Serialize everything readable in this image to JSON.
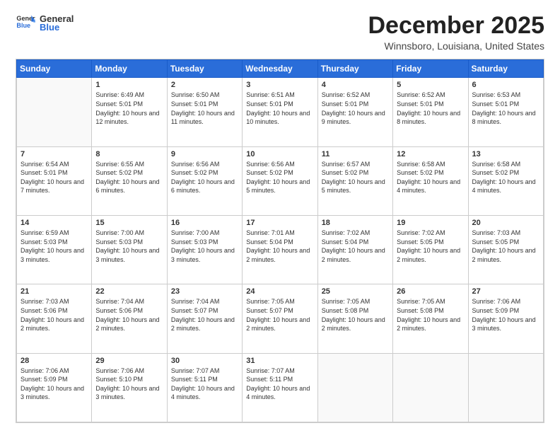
{
  "logo": {
    "general": "General",
    "blue": "Blue"
  },
  "header": {
    "month": "December 2025",
    "location": "Winnsboro, Louisiana, United States"
  },
  "weekdays": [
    "Sunday",
    "Monday",
    "Tuesday",
    "Wednesday",
    "Thursday",
    "Friday",
    "Saturday"
  ],
  "weeks": [
    [
      {
        "day": "",
        "info": ""
      },
      {
        "day": "1",
        "info": "Sunrise: 6:49 AM\nSunset: 5:01 PM\nDaylight: 10 hours\nand 12 minutes."
      },
      {
        "day": "2",
        "info": "Sunrise: 6:50 AM\nSunset: 5:01 PM\nDaylight: 10 hours\nand 11 minutes."
      },
      {
        "day": "3",
        "info": "Sunrise: 6:51 AM\nSunset: 5:01 PM\nDaylight: 10 hours\nand 10 minutes."
      },
      {
        "day": "4",
        "info": "Sunrise: 6:52 AM\nSunset: 5:01 PM\nDaylight: 10 hours\nand 9 minutes."
      },
      {
        "day": "5",
        "info": "Sunrise: 6:52 AM\nSunset: 5:01 PM\nDaylight: 10 hours\nand 8 minutes."
      },
      {
        "day": "6",
        "info": "Sunrise: 6:53 AM\nSunset: 5:01 PM\nDaylight: 10 hours\nand 8 minutes."
      }
    ],
    [
      {
        "day": "7",
        "info": "Sunrise: 6:54 AM\nSunset: 5:01 PM\nDaylight: 10 hours\nand 7 minutes."
      },
      {
        "day": "8",
        "info": "Sunrise: 6:55 AM\nSunset: 5:02 PM\nDaylight: 10 hours\nand 6 minutes."
      },
      {
        "day": "9",
        "info": "Sunrise: 6:56 AM\nSunset: 5:02 PM\nDaylight: 10 hours\nand 6 minutes."
      },
      {
        "day": "10",
        "info": "Sunrise: 6:56 AM\nSunset: 5:02 PM\nDaylight: 10 hours\nand 5 minutes."
      },
      {
        "day": "11",
        "info": "Sunrise: 6:57 AM\nSunset: 5:02 PM\nDaylight: 10 hours\nand 5 minutes."
      },
      {
        "day": "12",
        "info": "Sunrise: 6:58 AM\nSunset: 5:02 PM\nDaylight: 10 hours\nand 4 minutes."
      },
      {
        "day": "13",
        "info": "Sunrise: 6:58 AM\nSunset: 5:02 PM\nDaylight: 10 hours\nand 4 minutes."
      }
    ],
    [
      {
        "day": "14",
        "info": "Sunrise: 6:59 AM\nSunset: 5:03 PM\nDaylight: 10 hours\nand 3 minutes."
      },
      {
        "day": "15",
        "info": "Sunrise: 7:00 AM\nSunset: 5:03 PM\nDaylight: 10 hours\nand 3 minutes."
      },
      {
        "day": "16",
        "info": "Sunrise: 7:00 AM\nSunset: 5:03 PM\nDaylight: 10 hours\nand 3 minutes."
      },
      {
        "day": "17",
        "info": "Sunrise: 7:01 AM\nSunset: 5:04 PM\nDaylight: 10 hours\nand 2 minutes."
      },
      {
        "day": "18",
        "info": "Sunrise: 7:02 AM\nSunset: 5:04 PM\nDaylight: 10 hours\nand 2 minutes."
      },
      {
        "day": "19",
        "info": "Sunrise: 7:02 AM\nSunset: 5:05 PM\nDaylight: 10 hours\nand 2 minutes."
      },
      {
        "day": "20",
        "info": "Sunrise: 7:03 AM\nSunset: 5:05 PM\nDaylight: 10 hours\nand 2 minutes."
      }
    ],
    [
      {
        "day": "21",
        "info": "Sunrise: 7:03 AM\nSunset: 5:06 PM\nDaylight: 10 hours\nand 2 minutes."
      },
      {
        "day": "22",
        "info": "Sunrise: 7:04 AM\nSunset: 5:06 PM\nDaylight: 10 hours\nand 2 minutes."
      },
      {
        "day": "23",
        "info": "Sunrise: 7:04 AM\nSunset: 5:07 PM\nDaylight: 10 hours\nand 2 minutes."
      },
      {
        "day": "24",
        "info": "Sunrise: 7:05 AM\nSunset: 5:07 PM\nDaylight: 10 hours\nand 2 minutes."
      },
      {
        "day": "25",
        "info": "Sunrise: 7:05 AM\nSunset: 5:08 PM\nDaylight: 10 hours\nand 2 minutes."
      },
      {
        "day": "26",
        "info": "Sunrise: 7:05 AM\nSunset: 5:08 PM\nDaylight: 10 hours\nand 2 minutes."
      },
      {
        "day": "27",
        "info": "Sunrise: 7:06 AM\nSunset: 5:09 PM\nDaylight: 10 hours\nand 3 minutes."
      }
    ],
    [
      {
        "day": "28",
        "info": "Sunrise: 7:06 AM\nSunset: 5:09 PM\nDaylight: 10 hours\nand 3 minutes."
      },
      {
        "day": "29",
        "info": "Sunrise: 7:06 AM\nSunset: 5:10 PM\nDaylight: 10 hours\nand 3 minutes."
      },
      {
        "day": "30",
        "info": "Sunrise: 7:07 AM\nSunset: 5:11 PM\nDaylight: 10 hours\nand 4 minutes."
      },
      {
        "day": "31",
        "info": "Sunrise: 7:07 AM\nSunset: 5:11 PM\nDaylight: 10 hours\nand 4 minutes."
      },
      {
        "day": "",
        "info": ""
      },
      {
        "day": "",
        "info": ""
      },
      {
        "day": "",
        "info": ""
      }
    ]
  ]
}
